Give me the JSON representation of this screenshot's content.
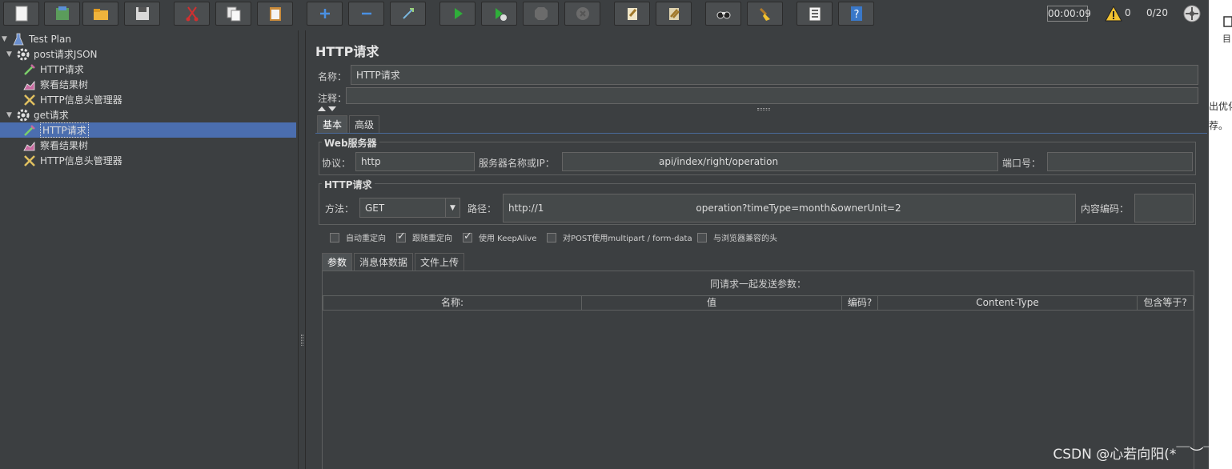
{
  "toolbar": {
    "timer": "00:00:09",
    "warning_count": "0",
    "thread_count": "0/20"
  },
  "tree": {
    "items": [
      {
        "label": "Test Plan"
      },
      {
        "label": "post请求JSON"
      },
      {
        "label": "HTTP请求"
      },
      {
        "label": "察看结果树"
      },
      {
        "label": "HTTP信息头管理器"
      },
      {
        "label": "get请求"
      },
      {
        "label": "HTTP请求"
      },
      {
        "label": "察看结果树"
      },
      {
        "label": "HTTP信息头管理器"
      }
    ]
  },
  "main": {
    "title": "HTTP请求",
    "name_label": "名称：",
    "name_value": "HTTP请求",
    "comment_label": "注释：",
    "tabs": [
      "基本",
      "高级"
    ],
    "web_server": {
      "title": "Web服务器",
      "protocol_label": "协议：",
      "protocol_value": "http",
      "server_label": "服务器名称或IP：",
      "server_value": "api/index/right/operation",
      "port_label": "端口号："
    },
    "http_request": {
      "title": "HTTP请求",
      "method_label": "方法：",
      "method_value": "GET",
      "path_label": "路径：",
      "path_value_start": "http://1",
      "path_value": "operation?timeType=month&ownerUnit=2",
      "encoding_label": "内容编码："
    },
    "checkboxes": [
      {
        "label": "自动重定向",
        "checked": false
      },
      {
        "label": "跟随重定向",
        "checked": true
      },
      {
        "label": "使用 KeepAlive",
        "checked": true
      },
      {
        "label": "对POST使用multipart / form-data",
        "checked": false
      },
      {
        "label": "与浏览器兼容的头",
        "checked": false
      }
    ],
    "param_tabs": [
      "参数",
      "消息体数据",
      "文件上传"
    ],
    "params_caption": "同请求一起发送参数：",
    "columns": [
      "名称:",
      "值",
      "编码?",
      "Content-Type",
      "包含等于?"
    ]
  },
  "watermark": "CSDN @心若向阳(*￣︶￣)",
  "right_strip": {
    "line1": "目",
    "line2": "出优化",
    "line3": "荐。"
  }
}
